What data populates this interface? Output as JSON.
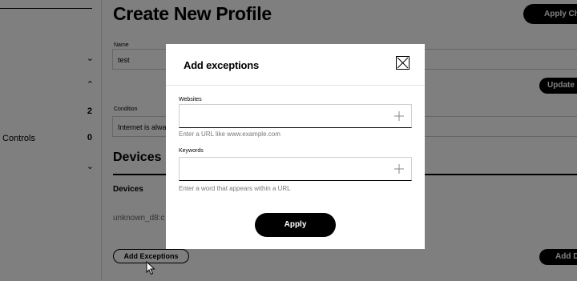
{
  "sidebar": {
    "rows": [
      {
        "label": "",
        "indicator": "⌄"
      },
      {
        "label": "",
        "indicator": "⌃"
      },
      {
        "label": "",
        "indicator": "2"
      },
      {
        "label": "Controls",
        "indicator": "0"
      },
      {
        "label": "",
        "indicator": "⌄"
      }
    ]
  },
  "page": {
    "title": "Create New Profile",
    "apply_changes_label": "Apply Changes",
    "name_label": "Name",
    "name_value": "test",
    "second_label": "",
    "update_label": "Update Schedule",
    "condition_label": "Condition",
    "condition_value": "Internet is always",
    "devices_heading": "Devices",
    "devices_subheading": "Devices",
    "device_name": "unknown_d8:c",
    "add_exceptions_label": "Add Exceptions",
    "add_device_label": "Add Device"
  },
  "modal": {
    "title": "Add exceptions",
    "websites_label": "Websites",
    "websites_value": "",
    "websites_help": "Enter a URL like www.example.com",
    "keywords_label": "Keywords",
    "keywords_value": "",
    "keywords_help": "Enter a word that appears within a URL",
    "apply_label": "Apply"
  },
  "icons": {
    "close": "close-icon",
    "add": "plus-icon",
    "cursor": "mouse-pointer-icon"
  },
  "colors": {
    "primary": "#000000",
    "overlay": "rgba(0,0,0,0.5)",
    "help_text": "#777777"
  }
}
